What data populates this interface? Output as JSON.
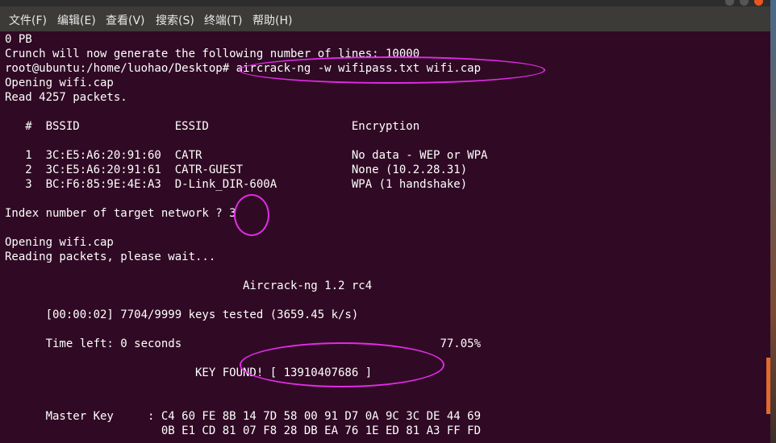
{
  "window": {
    "menu": [
      "文件(F)",
      "编辑(E)",
      "查看(V)",
      "搜索(S)",
      "终端(T)",
      "帮助(H)"
    ]
  },
  "terminal": {
    "lines": [
      "0 PB",
      "Crunch will now generate the following number of lines: 10000",
      "root@ubuntu:/home/luohao/Desktop# aircrack-ng -w wifipass.txt wifi.cap",
      "Opening wifi.cap",
      "Read 4257 packets.",
      "",
      "   #  BSSID              ESSID                     Encryption",
      "",
      "   1  3C:E5:A6:20:91:60  CATR                      No data - WEP or WPA",
      "   2  3C:E5:A6:20:91:61  CATR-GUEST                None (10.2.28.31)",
      "   3  BC:F6:85:9E:4E:A3  D-Link_DIR-600A           WPA (1 handshake)",
      "",
      "Index number of target network ? 3",
      "",
      "Opening wifi.cap",
      "Reading packets, please wait...",
      "",
      "                                   Aircrack-ng 1.2 rc4",
      "",
      "      [00:00:02] 7704/9999 keys tested (3659.45 k/s)",
      "",
      "      Time left: 0 seconds                                      77.05%",
      "",
      "                            KEY FOUND! [ 13910407686 ]",
      "",
      "",
      "      Master Key     : C4 60 FE 8B 14 7D 58 00 91 D7 0A 9C 3C DE 44 69",
      "                       0B E1 CD 81 07 F8 28 DB EA 76 1E ED 81 A3 FF FD"
    ]
  },
  "colors": {
    "terminal_bg": "#300a24",
    "terminal_fg": "#ffffff",
    "menubar_bg": "#3c3b37",
    "annotation": "#e02ce6",
    "scroll_thumb": "#e26a2c"
  }
}
